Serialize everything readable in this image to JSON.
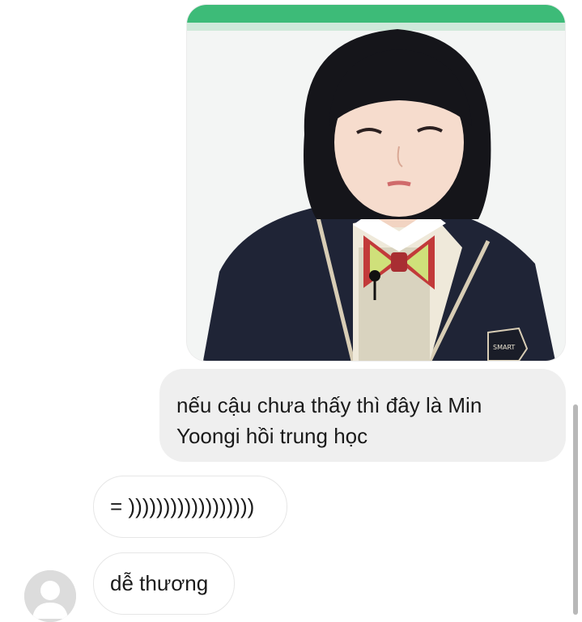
{
  "conversation": {
    "messages": [
      {
        "direction": "outgoing",
        "type": "photo"
      },
      {
        "direction": "outgoing",
        "type": "text",
        "text": "nếu cậu chưa thấy thì đây là Min Yoongi hồi trung học"
      },
      {
        "direction": "incoming",
        "type": "text",
        "text": "= ))))))))))))))))))"
      },
      {
        "direction": "incoming",
        "type": "text",
        "text": "dễ thương"
      }
    ]
  },
  "photo": {
    "badge_text": "SMART"
  },
  "colors": {
    "outgoing_bubble": "#efefef",
    "incoming_bubble_border": "#e6e6e6",
    "photo_top_band": "#3dbb78"
  }
}
